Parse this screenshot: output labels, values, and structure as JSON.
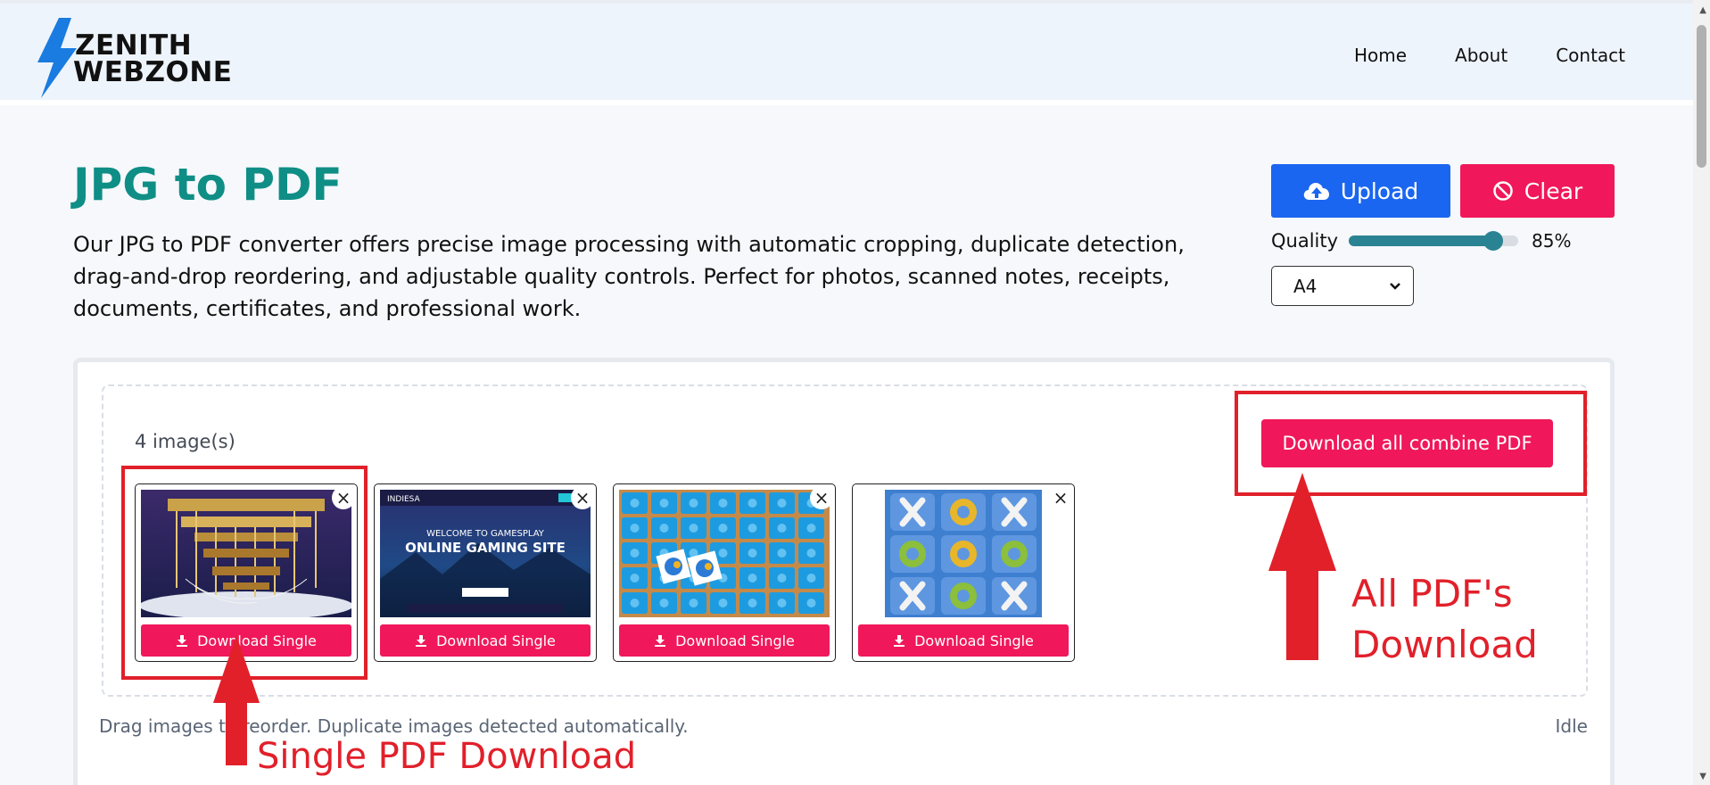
{
  "brand": {
    "line1": "ZENITH",
    "line2": "WEBZONE",
    "accent_color": "#1a7be0"
  },
  "nav": {
    "items": [
      "Home",
      "About",
      "Contact"
    ]
  },
  "main": {
    "title": "JPG to PDF",
    "description": "Our JPG to PDF converter offers precise image processing with automatic cropping, duplicate detection, drag-and-drop reordering, and adjustable quality controls. Perfect for photos, scanned notes, receipts, documents, certificates, and professional work."
  },
  "controls": {
    "upload_label": "Upload",
    "clear_label": "Clear",
    "quality_label": "Quality",
    "quality_value": 85,
    "quality_text": "85%",
    "page_size": "A4"
  },
  "workspace": {
    "count_text": "4 image(s)",
    "combine_label": "Download all combine PDF",
    "hint": "Drag images to reorder. Duplicate images detected automatically.",
    "status": "Idle",
    "cards": [
      {
        "download_label": "Download Single",
        "close": "×",
        "thumb": "quantum-computer-image"
      },
      {
        "download_label": "Download Single",
        "close": "×",
        "thumb": "gaming-site-image",
        "thumb_text_top": "INDIESA",
        "thumb_text_1": "WELCOME TO GAMESPLAY",
        "thumb_text_2": "ONLINE GAMING SITE"
      },
      {
        "download_label": "Download Single",
        "close": "×",
        "thumb": "memory-game-image"
      },
      {
        "download_label": "Download Single",
        "close": "×",
        "thumb": "tic-tac-toe-image"
      }
    ]
  },
  "annotations": {
    "all_download_1": "All PDF's",
    "all_download_2": "Download",
    "single_download": "Single PDF Download"
  },
  "colors": {
    "primary_blue": "#1a66f0",
    "accent_pink": "#f0185a",
    "title_teal": "#0f8e86",
    "annotation_red": "#e1202a"
  }
}
